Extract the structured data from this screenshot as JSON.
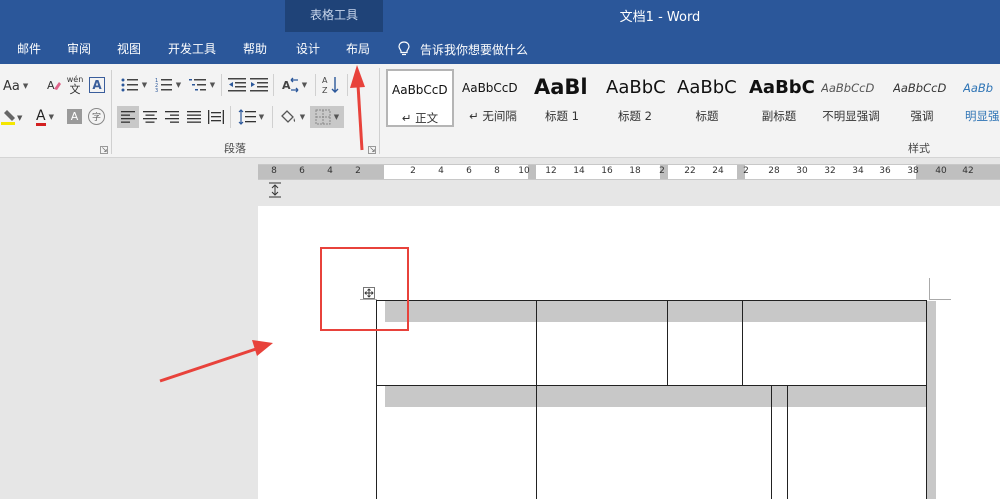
{
  "titlebar": {
    "tools_label": "表格工具",
    "document_title": "文档1  -  Word"
  },
  "tabs": [
    {
      "label": "邮件"
    },
    {
      "label": "审阅"
    },
    {
      "label": "视图"
    },
    {
      "label": "开发工具"
    },
    {
      "label": "帮助"
    },
    {
      "label": "设计"
    },
    {
      "label": "布局"
    }
  ],
  "tell_me": {
    "label": "告诉我你想要做什么",
    "icon": "lightbulb-icon"
  },
  "ribbon": {
    "font_size_button": "Aa",
    "phonetic_top": "wén",
    "phonetic_bottom": "文",
    "char_border": "A",
    "font_color_label": "A",
    "char_shading": "A",
    "enclose_char": "字",
    "paragraph_group_label": "段落",
    "styles_group_label": "样式",
    "sort_label": "A↓Z"
  },
  "styles": [
    {
      "sample": "AaBbCcD",
      "name": "↵ 正文",
      "kind": "normal"
    },
    {
      "sample": "AaBbCcD",
      "name": "↵ 无间隔",
      "kind": "small"
    },
    {
      "sample": "AaBl",
      "name": "标题 1",
      "kind": "h1"
    },
    {
      "sample": "AaBbC",
      "name": "标题 2",
      "kind": "h2"
    },
    {
      "sample": "AaBbC",
      "name": "标题",
      "kind": "title"
    },
    {
      "sample": "AaBbC",
      "name": "副标题",
      "kind": "subtitle"
    },
    {
      "sample": "AaBbCcD",
      "name": "不明显强调",
      "kind": "subtle"
    },
    {
      "sample": "AaBbCcD",
      "name": "强调",
      "kind": "emphasis"
    },
    {
      "sample": "AaBb",
      "name": "明显强",
      "kind": "intense"
    }
  ],
  "ruler": {
    "left_numbers": [
      "8",
      "6",
      "4",
      "2"
    ],
    "right_numbers": [
      "2",
      "4",
      "6",
      "8",
      "10",
      "12",
      "14",
      "16",
      "18",
      "2",
      "22",
      "24",
      "2",
      "28",
      "30",
      "32",
      "34",
      "36",
      "38",
      "40",
      "42"
    ]
  },
  "colors": {
    "word_blue": "#2b579a",
    "context_tab": "#1f4378",
    "annotation_red": "#e8423b",
    "highlight_yellow": "#f5e600",
    "font_red": "#d32020"
  }
}
